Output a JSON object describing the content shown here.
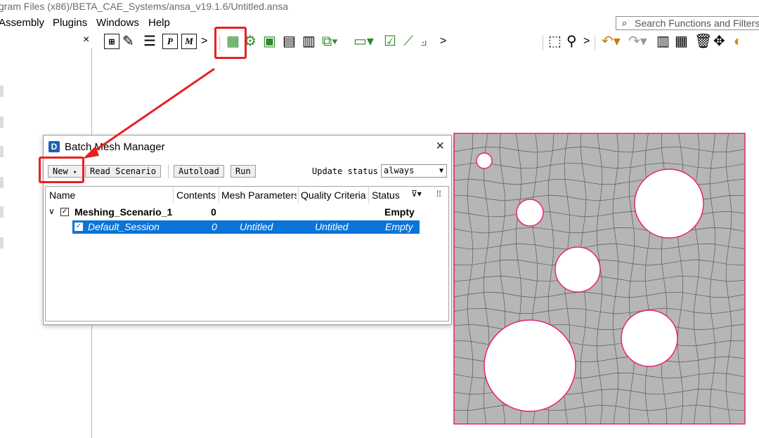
{
  "window": {
    "title": "gram Files (x86)/BETA_CAE_Systems/ansa_v19.1.6/Untitled.ansa"
  },
  "menu": {
    "items": [
      "Assembly",
      "Plugins",
      "Windows",
      "Help"
    ]
  },
  "search": {
    "placeholder": "Search Functions and Filters"
  },
  "toolbar": {
    "close_glyph": "×",
    "overflow_glyph": ">",
    "highlighted_tool": "batch-mesh-manager-icon"
  },
  "dialog": {
    "title": "Batch Mesh Manager",
    "close_glyph": "×",
    "buttons": {
      "new": "New",
      "read_scenario": "Read Scenario",
      "autoload": "Autoload",
      "run": "Run"
    },
    "update_status_label": "Update status",
    "update_status_value": "always",
    "columns": [
      "Name",
      "Contents",
      "Mesh Parameters",
      "Quality Criteria",
      "Status"
    ],
    "scenario": {
      "name": "Meshing_Scenario_1",
      "contents": "0",
      "mesh_parameters": "",
      "quality_criteria": "",
      "status": "Empty"
    },
    "session": {
      "name": "Default_Session",
      "contents": "0",
      "mesh_parameters": "Untitled",
      "quality_criteria": "Untitled",
      "status": "Empty"
    }
  },
  "colors": {
    "highlight": "#e8201f",
    "selection": "#0a74d8",
    "mesh_fill": "#b6b6b6",
    "mesh_edge": "#e8207a"
  }
}
